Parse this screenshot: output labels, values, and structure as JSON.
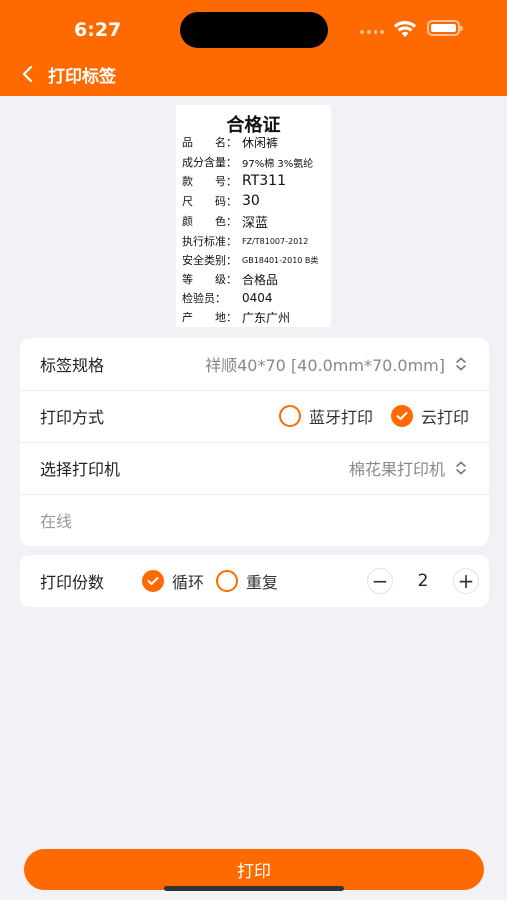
{
  "status_bar": {
    "time": "6:27"
  },
  "nav": {
    "title": "打印标签",
    "back_icon": "chevron-left-icon"
  },
  "label_preview": {
    "title": "合格证",
    "rows": [
      {
        "key": "品　　名：",
        "value": "休闲裤"
      },
      {
        "key": "成分含量：",
        "value": "97%棉 3%氨纶"
      },
      {
        "key": "款　　号：",
        "value": "RT311"
      },
      {
        "key": "尺　　码：",
        "value": "30"
      },
      {
        "key": "颜　　色：",
        "value": "深蓝"
      },
      {
        "key": "执行标准：",
        "value": "FZ/T81007-2012"
      },
      {
        "key": "安全类别：",
        "value": "GB18401-2010 B类"
      },
      {
        "key": "等　　级：",
        "value": "合格品"
      },
      {
        "key": "检验员：",
        "value": "0404"
      },
      {
        "key": "产　　地：",
        "value": "广东广州"
      }
    ]
  },
  "settings": {
    "spec_label": "标签规格",
    "spec_value": "祥顺40*70 [40.0mm*70.0mm]",
    "method_label": "打印方式",
    "method_options": [
      {
        "label": "蓝牙打印",
        "checked": false
      },
      {
        "label": "云打印",
        "checked": true
      }
    ],
    "printer_label": "选择打印机",
    "printer_value": "棉花果打印机",
    "printer_status": "在线"
  },
  "copies": {
    "label": "打印份数",
    "options": [
      {
        "label": "循环",
        "checked": true
      },
      {
        "label": "重复",
        "checked": false
      }
    ],
    "value": "2",
    "minus": "−",
    "plus": "+"
  },
  "print_button": "打印",
  "colors": {
    "accent": "#ff6a00",
    "background": "#f2f2f6"
  }
}
